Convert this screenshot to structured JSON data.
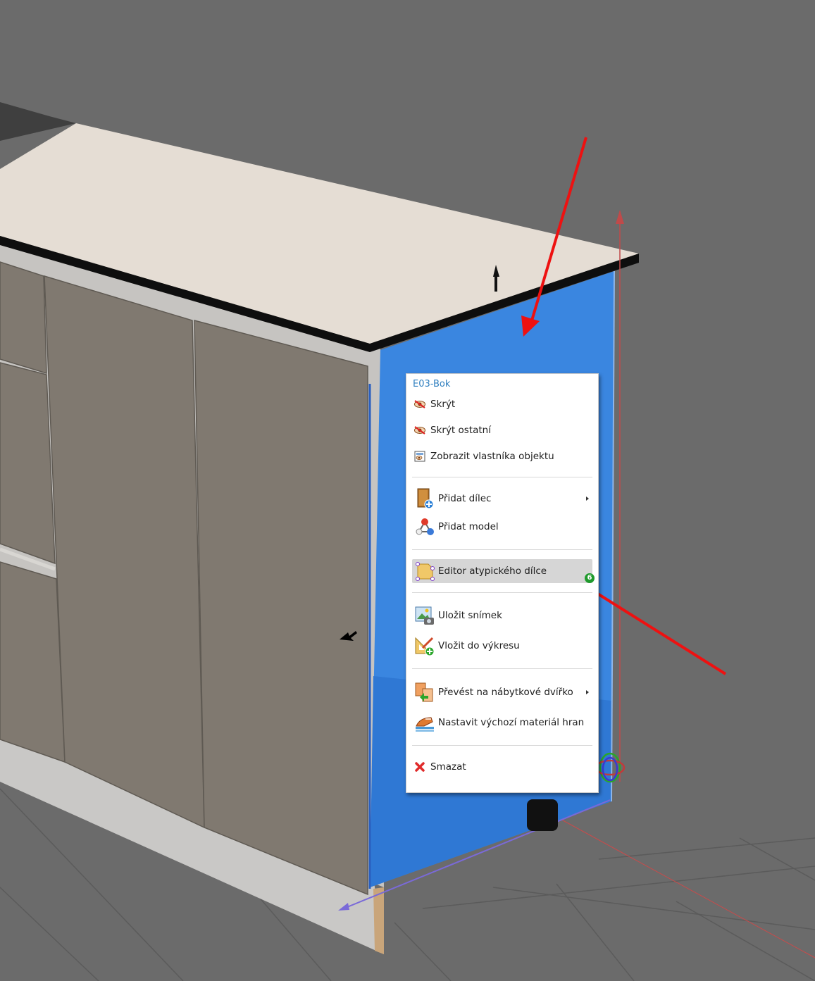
{
  "context_menu": {
    "title": "E03-Bok",
    "items": [
      {
        "label": "Skrýt",
        "icon": "eye-hide-icon"
      },
      {
        "label": "Skrýt ostatní",
        "icon": "eye-hide-others-icon"
      },
      {
        "label": "Zobrazit vlastníka objektu",
        "icon": "show-owner-icon"
      },
      {
        "label": "Přidat dílec",
        "icon": "add-panel-icon",
        "has_submenu": true
      },
      {
        "label": "Přidat model",
        "icon": "add-model-icon"
      },
      {
        "label": "Editor atypického dílce",
        "icon": "atypical-part-editor-icon",
        "highlighted": true
      },
      {
        "label": "Uložit snímek",
        "icon": "save-snapshot-icon"
      },
      {
        "label": "Vložit do výkresu",
        "icon": "insert-to-drawing-icon"
      },
      {
        "label": "Převést na nábytkové dvířko",
        "icon": "convert-to-door-icon",
        "has_submenu": true
      },
      {
        "label": "Nastavit výchozí materiál hran",
        "icon": "edge-material-icon"
      },
      {
        "label": "Smazat",
        "icon": "delete-icon"
      }
    ],
    "step_badge": "6"
  },
  "colors": {
    "background": "#6b6b6b",
    "selected_panel": "#3a86e0",
    "annotation_arrow": "#ee1111",
    "highlight": "#d6d6d6",
    "title_text": "#2f7fbf"
  }
}
